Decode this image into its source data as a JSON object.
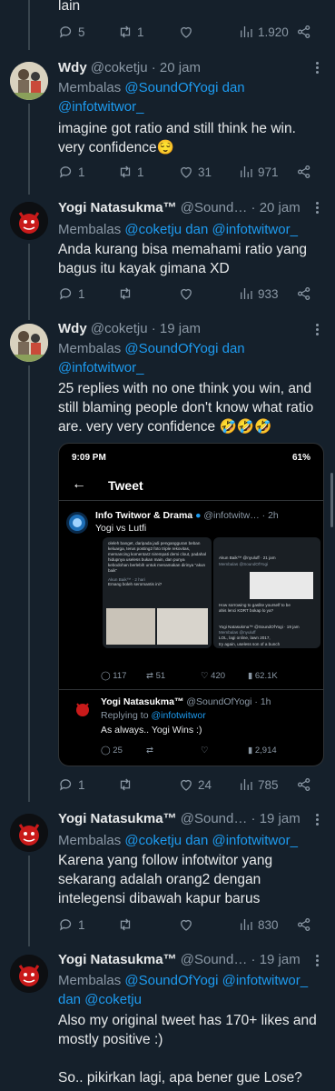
{
  "top": {
    "text_fragment": "lain",
    "replies": "5",
    "retweets": "1",
    "views": "1.920"
  },
  "tweets": [
    {
      "name": "Wdy",
      "handle": "@coketju · 20 jam",
      "reply_prefix": "Membalas",
      "reply_to": "@SoundOfYogi dan @infotwitwor_",
      "text": "imagine got ratio and still think he win. very confidence😌",
      "replies": "1",
      "retweets": "1",
      "likes": "31",
      "views": "971"
    },
    {
      "name": "Yogi Natasukma™",
      "handle": "@Sound… · 20 jam",
      "reply_prefix": "Membalas",
      "reply_to": "@coketju dan @infotwitwor_",
      "text": "Anda kurang bisa memahami ratio yang bagus itu kayak gimana XD",
      "replies": "1",
      "retweets": "",
      "likes": "",
      "views": "933"
    },
    {
      "name": "Wdy",
      "handle": "@coketju · 19 jam",
      "reply_prefix": "Membalas",
      "reply_to": "@SoundOfYogi dan @infotwitwor_",
      "text": "25 replies with no one think you win, and still blaming people don't know what ratio are. very very confidence 🤣🤣🤣",
      "replies": "1",
      "retweets": "",
      "likes": "24",
      "views": "785"
    },
    {
      "name": "Yogi Natasukma™",
      "handle": "@Sound… · 19 jam",
      "reply_prefix": "Membalas",
      "reply_to": "@coketju dan @infotwitwor_",
      "text": "Karena yang follow infotwitor yang sekarang adalah orang2 dengan intelegensi dibawah kapur barus",
      "replies": "1",
      "retweets": "",
      "likes": "",
      "views": "830"
    },
    {
      "name": "Yogi Natasukma™",
      "handle": "@Sound… · 19 jam",
      "reply_prefix": "Membalas",
      "reply_to": "@SoundOfYogi @infotwitwor_ dan @coketju",
      "text": "Also my original tweet has 170+ likes and mostly positive :)",
      "text2": "So.. pikirkan lagi, apa bener gue Lose?"
    }
  ],
  "embed": {
    "status_time": "9:09 PM",
    "battery": "61%",
    "header": "Tweet",
    "quoted_name": "Info Twitwor & Drama",
    "quoted_handle": "@infotwitw…  · 2h",
    "quoted_text": "Yogi vs Lutfi",
    "img_text_1": "oleleh banget, daripada jadi pengangguran beban keluarga, terus posting2 foto triple rekovitas, memancing komentar2 nirempati demi clout, padahal hidupnya useless bukan main, dan punya kebodohan berlebih untuk menamakan dirinya \"akun baik\"",
    "img_sub": "Akun Baik™ · 2 hari",
    "img_sub_text": "Emang boleh seromantis ini?",
    "right_1": "Akun Baik™ @nyuluff · 21 jam",
    "right_1b": "Membalas @SoundOfYogi",
    "right_2": "How sorrowing to gaslite yourself to be",
    "right_2b": "ahis lenci KDRT bokap lo ya?",
    "right_3": "Yogi Natasukma™ @SoundOfYogi · 19 jam",
    "right_3b": "Membalas @nyuluff",
    "right_3c": "LOL, lagi online, lawn 2017,",
    "right_3d": "try again, useless son of a bunch",
    "stats_replies": "117",
    "stats_rt": "51",
    "stats_likes": "420",
    "stats_views": "62.1K",
    "reply_name": "Yogi Natasukma™",
    "reply_handle": "@SoundOfYogi · 1h",
    "reply_prefix": "Replying to",
    "reply_to": "@infotwitwor",
    "reply_text": "As always.. Yogi Wins :)",
    "reply_replies": "25",
    "reply_views": "2,914"
  },
  "colors": {
    "bg": "#15202b",
    "accent": "#1d9bf0",
    "muted": "#8b98a5"
  }
}
